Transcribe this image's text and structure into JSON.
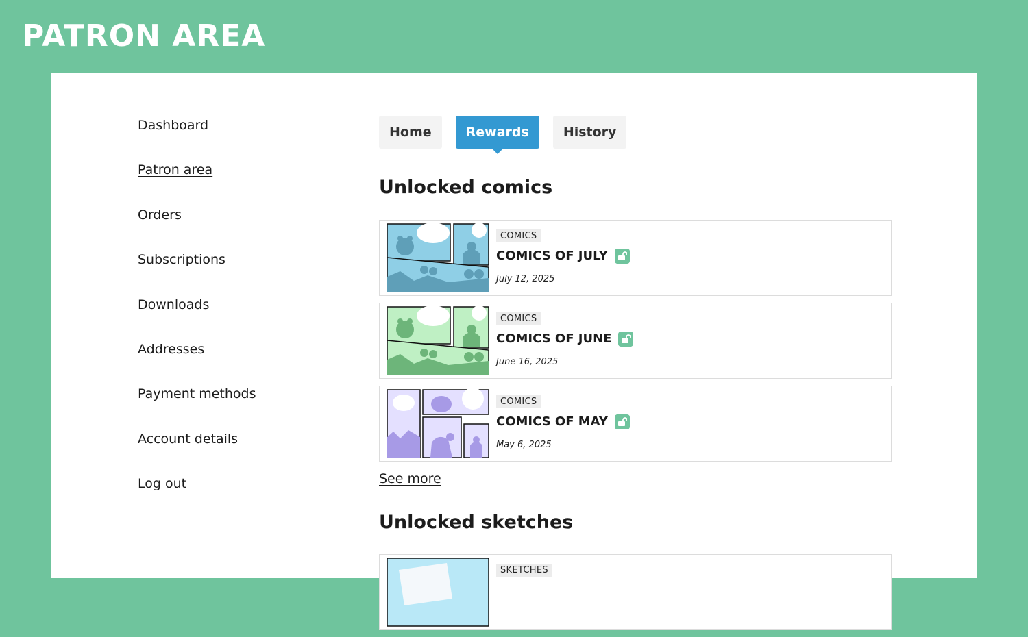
{
  "header": {
    "title": "Patron Area"
  },
  "sidebar": {
    "items": [
      {
        "label": "Dashboard"
      },
      {
        "label": "Patron area",
        "current": true
      },
      {
        "label": "Orders"
      },
      {
        "label": "Subscriptions"
      },
      {
        "label": "Downloads"
      },
      {
        "label": "Addresses"
      },
      {
        "label": "Payment methods"
      },
      {
        "label": "Account details"
      },
      {
        "label": "Log out"
      }
    ]
  },
  "tabs": [
    {
      "label": "Home"
    },
    {
      "label": "Rewards",
      "active": true
    },
    {
      "label": "History"
    }
  ],
  "comics": {
    "heading": "Unlocked comics",
    "items": [
      {
        "category": "COMICS",
        "title": "COMICS OF JULY",
        "date": "July 12, 2025",
        "thumb_color": "#8fcfe6"
      },
      {
        "category": "COMICS",
        "title": "COMICS OF JUNE",
        "date": "June 16, 2025",
        "thumb_color": "#8fd69a"
      },
      {
        "category": "COMICS",
        "title": "COMICS OF MAY",
        "date": "May 6, 2025",
        "thumb_color": "#a79ae6"
      }
    ],
    "see_more": "See more"
  },
  "sketches": {
    "heading": "Unlocked sketches",
    "items": [
      {
        "category": "SKETCHES",
        "thumb_color": "#8fcfe6"
      }
    ]
  },
  "colors": {
    "brand": "#6fc49d",
    "accent": "#3399d2",
    "unlock_icon_bg": "#6fc49d"
  }
}
